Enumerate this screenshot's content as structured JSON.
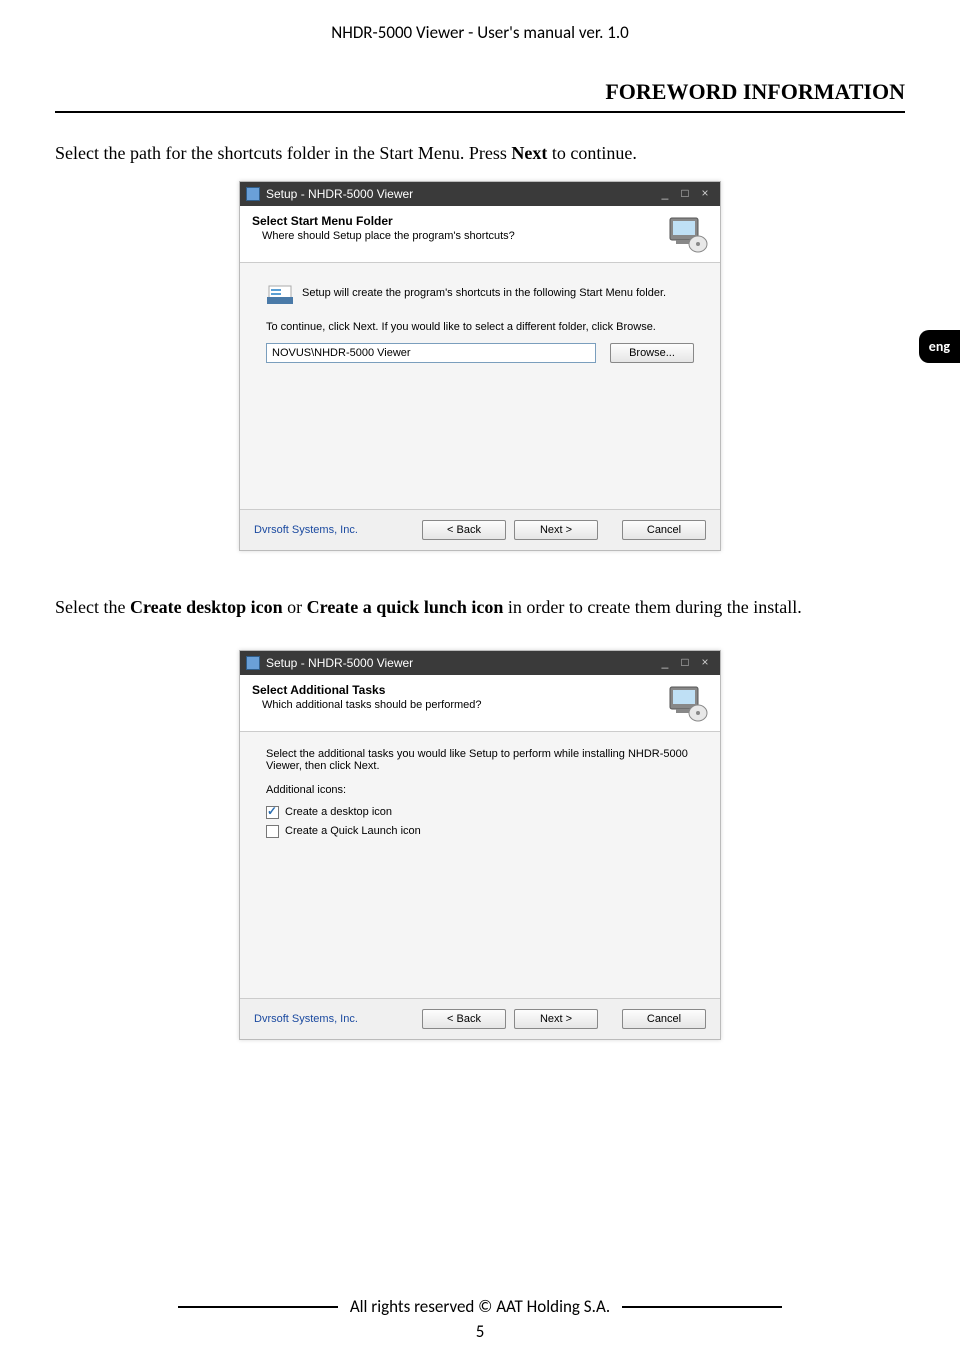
{
  "doc_header": "NHDR-5000 Viewer - User's manual ver. 1.0",
  "section_title": "FOREWORD INFORMATION",
  "para1_a": "Select the path for the shortcuts folder in the Start Menu. Press ",
  "para1_b": "Next",
  "para1_c": " to continue.",
  "lang_tab": "eng",
  "para2_a": "Select the ",
  "para2_b": "Create desktop icon ",
  "para2_c": "or ",
  "para2_d": "Create a quick lunch icon ",
  "para2_e": "in order to create them during the install.",
  "footer_text": "All rights reserved © AAT Holding S.A.",
  "page_number": "5",
  "installer1": {
    "window_title": "Setup - NHDR-5000 Viewer",
    "header_title": "Select Start Menu Folder",
    "header_sub": "Where should Setup place the program's shortcuts?",
    "line1": "Setup will create the program's shortcuts in the following Start Menu folder.",
    "line2": "To continue, click Next. If you would like to select a different folder, click Browse.",
    "path_value": "NOVUS\\NHDR-5000 Viewer",
    "browse_label": "Browse...",
    "vendor": "Dvrsoft Systems, Inc.",
    "back_label": "< Back",
    "next_label": "Next >",
    "cancel_label": "Cancel"
  },
  "installer2": {
    "window_title": "Setup - NHDR-5000 Viewer",
    "header_title": "Select Additional Tasks",
    "header_sub": "Which additional tasks should be performed?",
    "line1": "Select the additional tasks you would like Setup to perform while installing NHDR-5000 Viewer, then click Next.",
    "section_label": "Additional icons:",
    "chk1_label": "Create a desktop icon",
    "chk2_label": "Create a Quick Launch icon",
    "vendor": "Dvrsoft Systems, Inc.",
    "back_label": "< Back",
    "next_label": "Next >",
    "cancel_label": "Cancel"
  }
}
